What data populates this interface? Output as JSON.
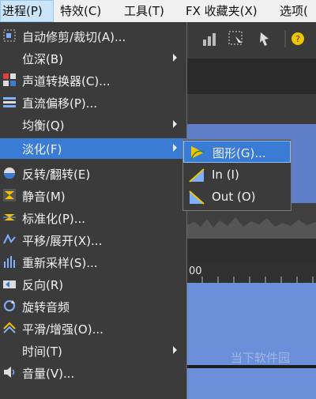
{
  "menubar": {
    "items": [
      {
        "label": "进程(P)",
        "active": true
      },
      {
        "label": "特效(C)"
      },
      {
        "label": "工具(T)"
      },
      {
        "label": "FX 收藏夹(X)"
      },
      {
        "label": "选项("
      }
    ]
  },
  "menu": {
    "items": [
      {
        "label": "自动修剪/裁切(A)...",
        "icon": "auto-trim-icon"
      },
      {
        "label": "位深(B)",
        "submenu": true
      },
      {
        "label": "声道转换器(C)...",
        "icon": "channel-converter-icon"
      },
      {
        "label": "直流偏移(P)...",
        "icon": "dc-offset-icon"
      },
      {
        "label": "均衡(Q)",
        "submenu": true
      },
      {
        "label": "淡化(F)",
        "submenu": true,
        "highlighted": true
      },
      {
        "label": "反转/翻转(E)",
        "icon": "invert-icon"
      },
      {
        "label": "静音(M)",
        "icon": "mute-icon"
      },
      {
        "label": "标准化(P)...",
        "icon": "normalize-icon"
      },
      {
        "label": "平移/展开(X)...",
        "icon": "pan-expand-icon"
      },
      {
        "label": "重新采样(S)...",
        "icon": "resample-icon"
      },
      {
        "label": "反向(R)",
        "icon": "reverse-icon"
      },
      {
        "label": "旋转音频",
        "icon": "rotate-audio-icon"
      },
      {
        "label": "平滑/增强(O)...",
        "icon": "smooth-enhance-icon"
      },
      {
        "label": "时间(T)",
        "submenu": true
      },
      {
        "label": "音量(V)...",
        "icon": "volume-icon"
      }
    ]
  },
  "submenu": {
    "items": [
      {
        "label": "图形(G)...",
        "highlighted": true,
        "icon": "graph-fade-icon"
      },
      {
        "label": "In (I)",
        "icon": "fade-in-icon"
      },
      {
        "label": "Out (O)",
        "icon": "fade-out-icon"
      }
    ]
  },
  "ruler": {
    "label": "00"
  },
  "watermark": {
    "text": "当下软件园"
  },
  "colors": {
    "highlight": "#3a7bd5",
    "menu_bg": "#3b3b3b",
    "waveform": "#6b8fd9"
  }
}
